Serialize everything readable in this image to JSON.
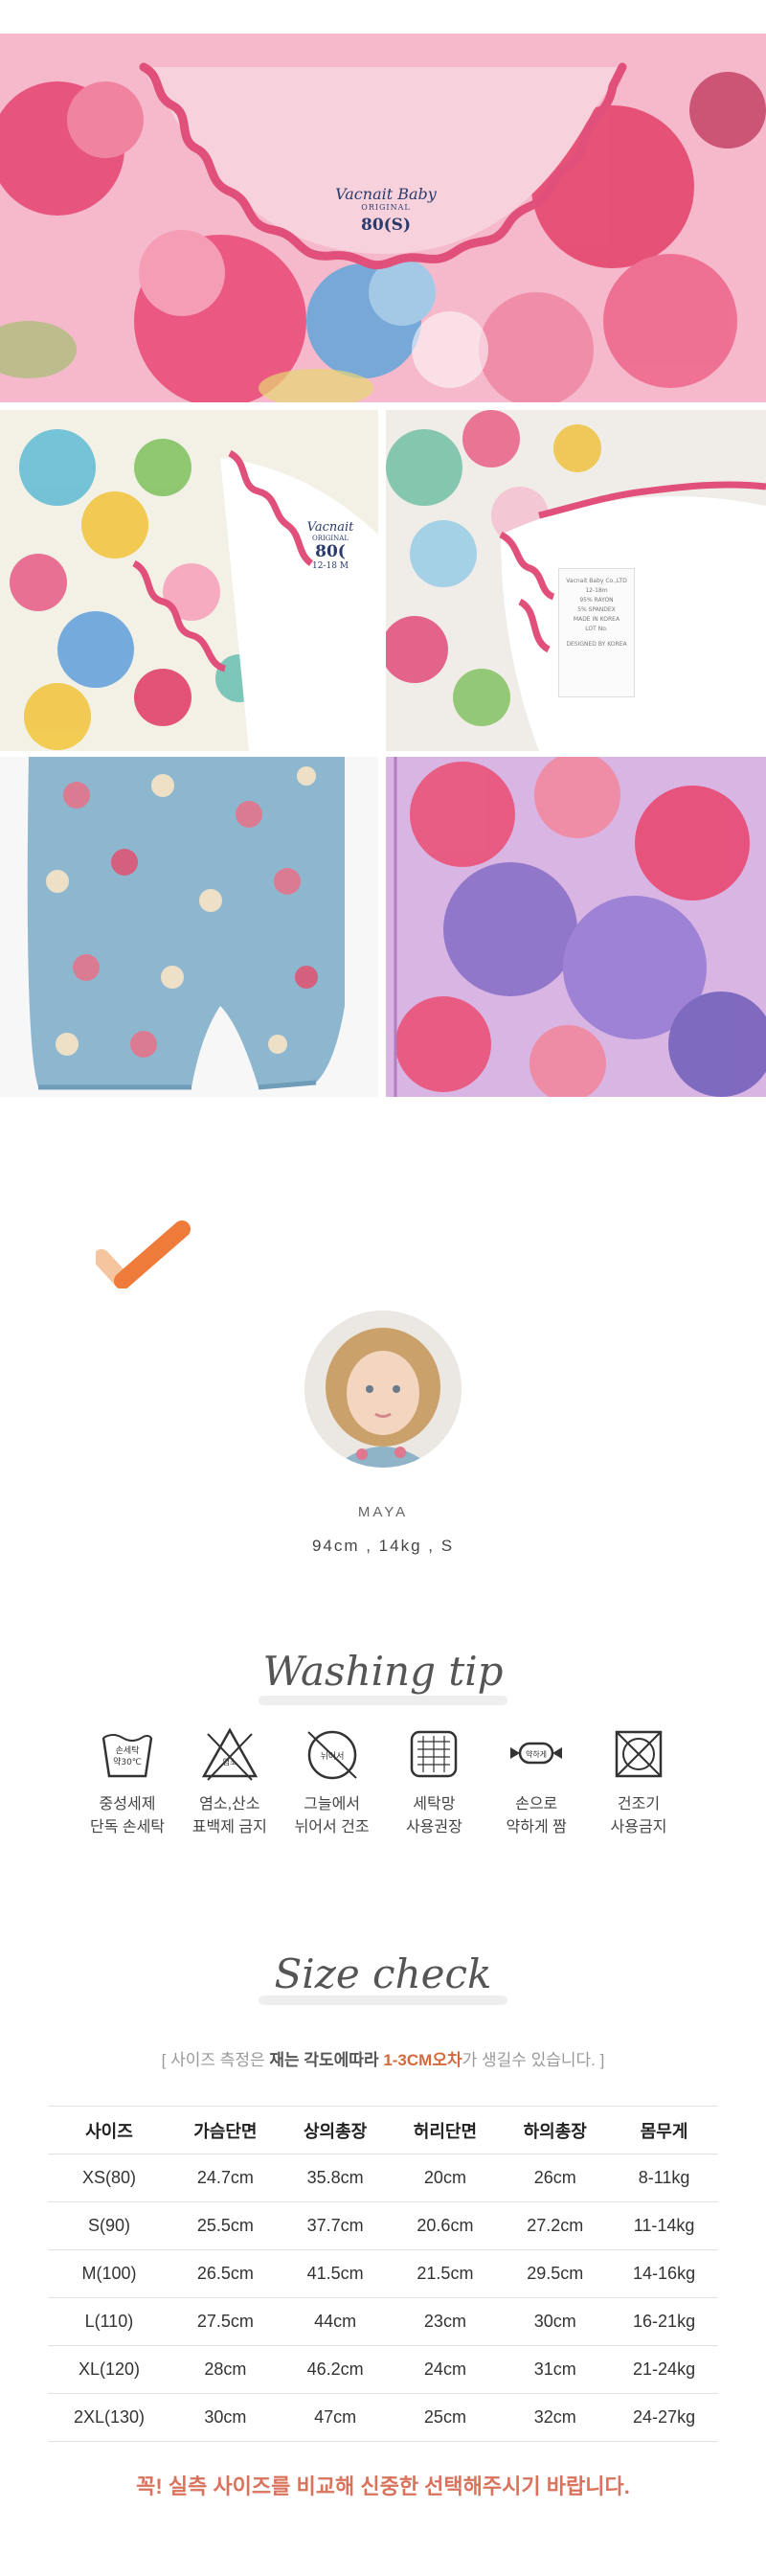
{
  "top_label": {
    "brand": "Vacnait Baby",
    "sub": "ORIGINAL",
    "size": "80(S)"
  },
  "mid_left_label": {
    "brand": "Vacnait",
    "line2": "ORIGINAL",
    "size": "80(",
    "age": "12-18 M"
  },
  "care_label": {
    "lines": [
      "Vacnait Baby Co.,LTD",
      "12-18m",
      "95% RAYON",
      "5% SPANDEX",
      "MADE IN KOREA",
      "LOT No.",
      "DESIGNED BY KOREA"
    ]
  },
  "model": {
    "name": "MAYA",
    "info": "94cm , 14kg , S"
  },
  "washing": {
    "title": "Washing tip",
    "items": [
      {
        "icon": "hand-wash-30-icon",
        "line1": "중성세제",
        "line2": "단독 손세탁"
      },
      {
        "icon": "no-bleach-icon",
        "line1": "염소,산소",
        "line2": "표백제 금지"
      },
      {
        "icon": "shade-dry-icon",
        "line1": "그늘에서",
        "line2": "뉘어서 건조"
      },
      {
        "icon": "laundry-net-icon",
        "line1": "세탁망",
        "line2": "사용권장"
      },
      {
        "icon": "gentle-wring-icon",
        "line1": "손으로",
        "line2": "약하게 짬"
      },
      {
        "icon": "no-tumble-dry-icon",
        "line1": "건조기",
        "line2": "사용금지"
      }
    ]
  },
  "size_check": {
    "title": "Size check",
    "note_prefix": "[ 사이즈 측정은 ",
    "note_bold": "재는 각도에따라 ",
    "note_highlight": "1-3CM오차",
    "note_suffix": "가 생길수 있습니다. ]",
    "headers": [
      "사이즈",
      "가슴단면",
      "상의총장",
      "허리단면",
      "하의총장",
      "몸무게"
    ],
    "rows": [
      [
        "XS(80)",
        "24.7cm",
        "35.8cm",
        "20cm",
        "26cm",
        "8-11kg"
      ],
      [
        "S(90)",
        "25.5cm",
        "37.7cm",
        "20.6cm",
        "27.2cm",
        "11-14kg"
      ],
      [
        "M(100)",
        "26.5cm",
        "41.5cm",
        "21.5cm",
        "29.5cm",
        "14-16kg"
      ],
      [
        "L(110)",
        "27.5cm",
        "44cm",
        "23cm",
        "30cm",
        "16-21kg"
      ],
      [
        "XL(120)",
        "28cm",
        "46.2cm",
        "24cm",
        "31cm",
        "21-24kg"
      ],
      [
        "2XL(130)",
        "30cm",
        "47cm",
        "25cm",
        "32cm",
        "24-27kg"
      ]
    ],
    "bottom_note": "꼭! 실측 사이즈를 비교해 신중한 선택해주시기 바랍니다."
  },
  "colors": {
    "accent": "#ee7b3a",
    "trim": "#e0507a",
    "note": "#d9735d"
  }
}
